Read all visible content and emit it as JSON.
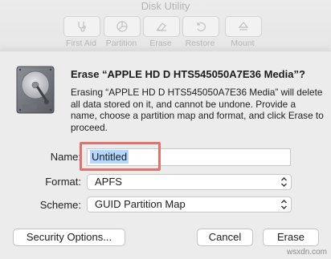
{
  "app": {
    "title": "Disk Utility"
  },
  "toolbar": {
    "items": [
      {
        "label": "First Aid",
        "icon": "stethoscope-icon"
      },
      {
        "label": "Partition",
        "icon": "pie-chart-icon"
      },
      {
        "label": "Erase",
        "icon": "erase-icon"
      },
      {
        "label": "Restore",
        "icon": "restore-icon"
      },
      {
        "label": "Mount",
        "icon": "eject-icon"
      }
    ]
  },
  "dialog": {
    "title": "Erase “APPLE HD D HTS545050A7E36 Media”?",
    "message": "Erasing “APPLE HD D HTS545050A7E36 Media” will delete all data stored on it, and cannot be undone. Provide a name, choose a partition map and format, and click Erase to proceed.",
    "icon": "hard-drive-icon",
    "fields": {
      "name_label": "Name:",
      "name_value": "Untitled",
      "format_label": "Format:",
      "format_value": "APFS",
      "scheme_label": "Scheme:",
      "scheme_value": "GUID Partition Map"
    },
    "buttons": {
      "security": "Security Options...",
      "cancel": "Cancel",
      "erase": "Erase"
    },
    "highlight_color": "#e2726a"
  },
  "watermark": "wsxdn.com"
}
